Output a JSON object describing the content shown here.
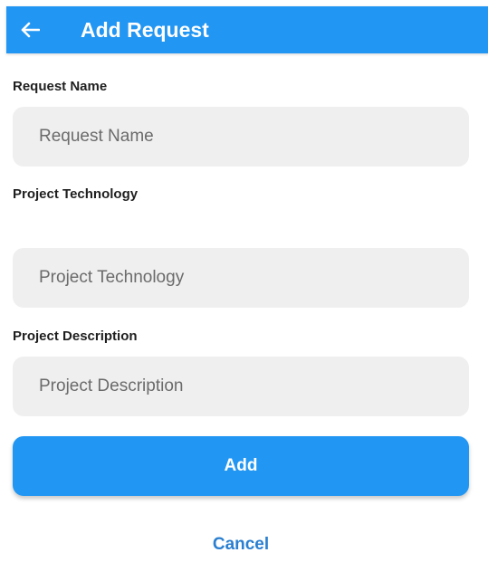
{
  "app_bar": {
    "back_icon": "arrow-left-icon",
    "title": "Add Request",
    "color": "#2196F3"
  },
  "form": {
    "request_name": {
      "label": "Request Name",
      "placeholder": "Request Name",
      "value": ""
    },
    "project_technology": {
      "label": "Project Technology",
      "placeholder": "Project Technology",
      "value": ""
    },
    "project_description": {
      "label": "Project Description",
      "placeholder": "Project Description",
      "value": ""
    }
  },
  "actions": {
    "add_label": "Add",
    "cancel_label": "Cancel",
    "primary_color": "#2196F3",
    "field_background": "#efefef"
  }
}
